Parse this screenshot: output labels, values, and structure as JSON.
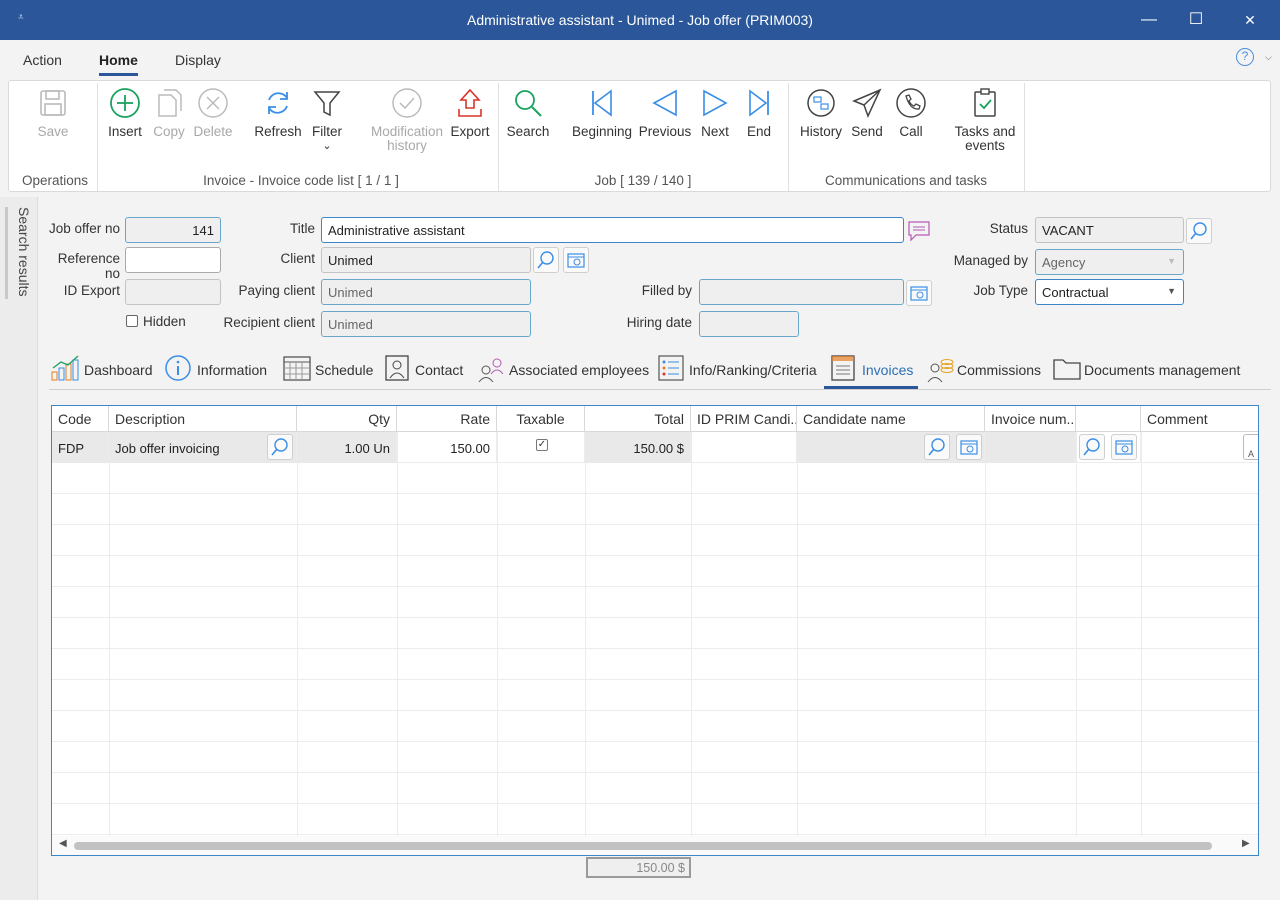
{
  "window": {
    "title": "Administrative assistant - Unimed - Job offer (PRIM003)",
    "system_menu_glyph": "⩡",
    "minimize_glyph": "—",
    "maximize_glyph": "☐",
    "close_glyph": "✕"
  },
  "menu": {
    "tabs": [
      "Action",
      "Home",
      "Display"
    ],
    "active": "Home",
    "help_glyph": "?",
    "help_caret_glyph": "⌵"
  },
  "ribbon": {
    "operations": {
      "label": "Operations",
      "save": "Save"
    },
    "invoice": {
      "label": "Invoice - Invoice code list [ 1 / 1 ]",
      "insert": "Insert",
      "copy": "Copy",
      "delete": "Delete",
      "refresh": "Refresh",
      "filter": "Filter",
      "filter_caret": "⌄",
      "modification_history_line1": "Modification",
      "modification_history_line2": "history",
      "export": "Export"
    },
    "job": {
      "label": "Job [ 139 / 140 ]",
      "search": "Search",
      "beginning": "Beginning",
      "previous": "Previous",
      "next": "Next",
      "end": "End"
    },
    "comms": {
      "label": "Communications and tasks",
      "history": "History",
      "send": "Send",
      "call": "Call",
      "tasks_line1": "Tasks and",
      "tasks_line2": "events"
    },
    "accent_color": "#1aa260",
    "nav_color": "#3a8ee6"
  },
  "side_panel": {
    "label": "Search results"
  },
  "form": {
    "job_offer_no": {
      "label": "Job offer no",
      "value": "141"
    },
    "reference_no": {
      "label": "Reference no",
      "value": ""
    },
    "id_export": {
      "label": "ID Export",
      "value": ""
    },
    "hidden": {
      "label": "Hidden",
      "checked": false
    },
    "title": {
      "label": "Title",
      "value": "Administrative assistant"
    },
    "client": {
      "label": "Client",
      "value": "Unimed"
    },
    "paying_client": {
      "label": "Paying client",
      "value": "Unimed"
    },
    "recipient_client": {
      "label": "Recipient client",
      "value": "Unimed"
    },
    "filled_by": {
      "label": "Filled by",
      "value": ""
    },
    "hiring_date": {
      "label": "Hiring date",
      "value": ""
    },
    "status": {
      "label": "Status",
      "value": "VACANT"
    },
    "managed_by": {
      "label": "Managed by",
      "value": "Agency"
    },
    "job_type": {
      "label": "Job Type",
      "value": "Contractual"
    },
    "dropdown_caret": "▼"
  },
  "tabs": {
    "items": [
      "Dashboard",
      "Information",
      "Schedule",
      "Contact",
      "Associated employees",
      "Info/Ranking/Criteria",
      "Invoices",
      "Commissions",
      "Documents management"
    ],
    "active": "Invoices"
  },
  "grid": {
    "columns": [
      "Code",
      "Description",
      "Qty",
      "Rate",
      "Taxable",
      "Total",
      "ID PRIM Candi...",
      "Candidate name",
      "Invoice num...",
      "",
      "Comment"
    ],
    "rows": [
      {
        "code": "FDP",
        "description": "Job offer invoicing",
        "qty": "1.00 Un",
        "rate": "150.00",
        "taxable": true,
        "taxable_glyph": "✓",
        "total": "150.00 $",
        "id_prim": "",
        "candidate_name": "",
        "invoice_num": "",
        "comment": "",
        "comment_edge_glyph": "A"
      }
    ],
    "scroll_left_glyph": "◀",
    "scroll_right_glyph": "▶"
  },
  "footer": {
    "total": "150.00 $"
  }
}
